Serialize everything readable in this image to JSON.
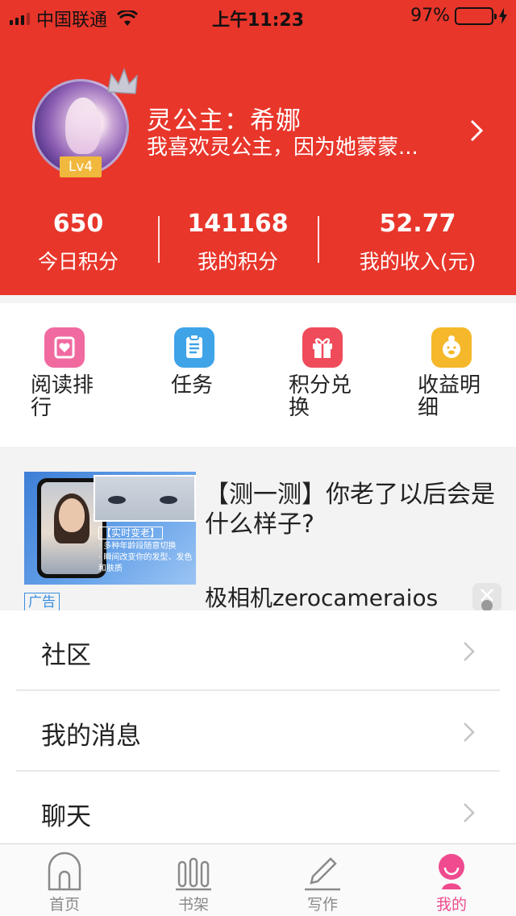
{
  "status_bar": {
    "carrier": "中国联通",
    "time": "上午11:23",
    "battery": "97%",
    "battery_level": 0.97
  },
  "profile": {
    "name": "灵公主：希娜",
    "bio": "我喜欢灵公主，因为她蒙蒙...",
    "level": "Lv4"
  },
  "stats": [
    {
      "value": "650",
      "label": "今日积分"
    },
    {
      "value": "141168",
      "label": "我的积分"
    },
    {
      "value": "52.77",
      "label": "我的收入(元)"
    }
  ],
  "shortcuts": [
    {
      "label": "阅读排行",
      "icon": "heart-book-icon",
      "color": "#f06aa0"
    },
    {
      "label": "任务",
      "icon": "clipboard-list-icon",
      "color": "#3fa3e8"
    },
    {
      "label": "积分兑换",
      "icon": "gift-box-icon",
      "color": "#ef4b5a"
    },
    {
      "label": "收益明细",
      "icon": "piggy-face-icon",
      "color": "#f5b82a"
    }
  ],
  "ad": {
    "tag": "广告",
    "title": "【测一测】你老了以后会是什么样子?",
    "source": "极相机zerocameraios",
    "image_caption_title": "【实时变老】",
    "image_caption_lines": [
      "· 多种年龄段随意切换",
      "· 瞬间改变你的发型、发色和肤质"
    ]
  },
  "menu": [
    {
      "label": "社区"
    },
    {
      "label": "我的消息"
    },
    {
      "label": "聊天"
    }
  ],
  "tabs": [
    {
      "label": "首页",
      "icon": "home-arch-icon"
    },
    {
      "label": "书架",
      "icon": "bookshelf-icon"
    },
    {
      "label": "写作",
      "icon": "pencil-icon"
    },
    {
      "label": "我的",
      "icon": "user-smile-icon",
      "active": true
    }
  ],
  "colors": {
    "header_red": "#e8362b",
    "level_badge": "#f0b83c",
    "active_tab": "#ef4b8e",
    "ad_tag_blue": "#3a8fe0"
  }
}
